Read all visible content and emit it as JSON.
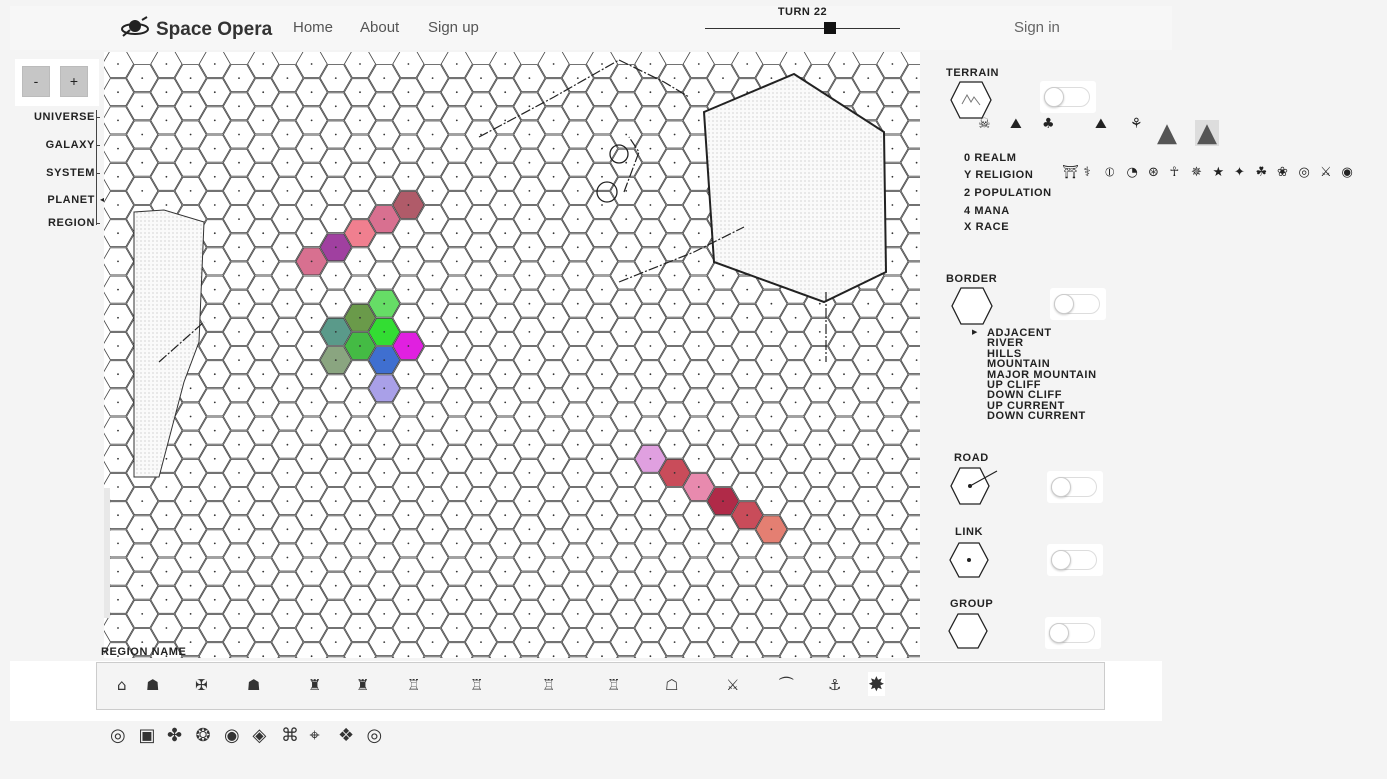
{
  "app": {
    "title": "Space Opera"
  },
  "nav": {
    "home": "Home",
    "about": "About",
    "signup": "Sign up",
    "signin": "Sign in"
  },
  "turn": {
    "label": "TURN 22",
    "position": 0.64
  },
  "zoom": {
    "minus": "-",
    "plus": "+"
  },
  "scale": {
    "items": [
      "UNIVERSE",
      "GALAXY",
      "SYSTEM",
      "PLANET",
      "REGION"
    ],
    "selected": "PLANET"
  },
  "terrain": {
    "label": "TERRAIN",
    "icons": [
      "skull-crossbones-icon",
      "snowy-peaks-icon",
      "forest-icon",
      "hills-icon",
      "palm-tree-icon",
      "mountain-icon",
      "major-mountain-icon"
    ],
    "toggle_on": false
  },
  "stats": [
    "0 REALM",
    "Y RELIGION",
    "2 POPULATION",
    "4 MANA",
    "X RACE"
  ],
  "religion_glyphs": [
    "⛩",
    "⚕",
    "⦶",
    "◔",
    "⊛",
    "☥",
    "✵",
    "★",
    "✦",
    "☘",
    "❀",
    "◎",
    "⚔",
    "◉"
  ],
  "border": {
    "label": "BORDER",
    "items": [
      "ADJACENT",
      "RIVER",
      "HILLS",
      "MOUNTAIN",
      "MAJOR MOUNTAIN",
      "UP CLIFF",
      "DOWN CLIFF",
      "UP CURRENT",
      "DOWN CURRENT"
    ],
    "selected": "ADJACENT",
    "toggle_on": false
  },
  "road": {
    "label": "ROAD",
    "toggle_on": false
  },
  "link": {
    "label": "LINK",
    "toggle_on": false
  },
  "group": {
    "label": "GROUP",
    "toggle_on": false
  },
  "region": {
    "label": "REGION NAME",
    "settlement_icons": [
      "⌂",
      "☗",
      "✠",
      "☗",
      "♜",
      "♜",
      "♖",
      "♖",
      "♖",
      "♖",
      "☖",
      "⚔",
      "⏜",
      "⚓",
      "✸"
    ],
    "settlement_names": [
      "hut-icon",
      "house-icon",
      "dragon-icon",
      "elephant-icon",
      "tower-icon",
      "castle-tower-icon",
      "village-icon",
      "town-icon",
      "city-icon",
      "fortress-icon",
      "guild-hall-icon",
      "crossed-swords-icon",
      "bridge-icon",
      "anchor-icon",
      "star-gate-icon"
    ]
  },
  "resource_icons": [
    "◎",
    "▣",
    "✤",
    "❂",
    "◉",
    "◈",
    "⌘",
    "⌖",
    "❖",
    "◎"
  ],
  "colors": {
    "purple_dark": "#a040a0",
    "rose": "#f07f8f",
    "rose_dark": "#b05b69",
    "mauve": "#d87090",
    "green_light": "#66dd66",
    "green": "#44bb44",
    "olive": "#6a9a4a",
    "teal": "#5a9a8a",
    "sage": "#8aa580",
    "blue": "#3f6fd0",
    "magenta": "#e020e0",
    "lavender": "#a9a0e8",
    "orchid": "#e0a0e0",
    "crimson": "#b02a48",
    "pink": "#e88aae",
    "salmon": "#e47f72",
    "coral": "#c94c5a"
  },
  "colored_hexes": [
    {
      "col": 12,
      "row": 5,
      "color": "#b05b69"
    },
    {
      "col": 11,
      "row": 5,
      "color": "#d87090"
    },
    {
      "col": 10,
      "row": 6,
      "color": "#f07f8f"
    },
    {
      "col": 9,
      "row": 6,
      "color": "#a040a0"
    },
    {
      "col": 8,
      "row": 7,
      "color": "#d87090"
    },
    {
      "col": 11,
      "row": 8,
      "color": "#66dd66"
    },
    {
      "col": 10,
      "row": 9,
      "color": "#6a9a4a"
    },
    {
      "col": 11,
      "row": 9,
      "color": "#33dd33"
    },
    {
      "col": 9,
      "row": 9,
      "color": "#5a9a8a"
    },
    {
      "col": 10,
      "row": 10,
      "color": "#44bb44"
    },
    {
      "col": 11,
      "row": 10,
      "color": "#3f6fd0"
    },
    {
      "col": 9,
      "row": 10,
      "color": "#8aa580"
    },
    {
      "col": 12,
      "row": 10,
      "color": "#e020e0"
    },
    {
      "col": 11,
      "row": 11,
      "color": "#a9a0e8"
    },
    {
      "col": 22,
      "row": 14,
      "color": "#e0a0e0"
    },
    {
      "col": 23,
      "row": 14,
      "color": "#c94c5a"
    },
    {
      "col": 24,
      "row": 15,
      "color": "#e88aae"
    },
    {
      "col": 25,
      "row": 15,
      "color": "#b02a48"
    },
    {
      "col": 26,
      "row": 16,
      "color": "#c94c5a"
    },
    {
      "col": 27,
      "row": 16,
      "color": "#e47f72"
    }
  ]
}
